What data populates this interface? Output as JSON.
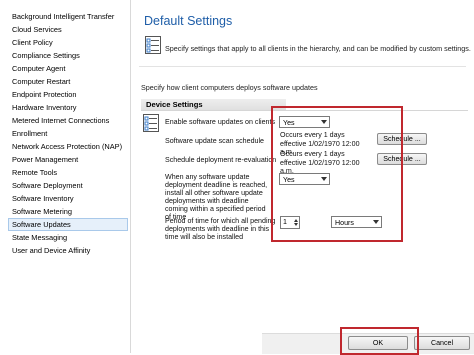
{
  "sidebar": {
    "items": [
      "Background Intelligent Transfer",
      "Cloud Services",
      "Client Policy",
      "Compliance Settings",
      "Computer Agent",
      "Computer Restart",
      "Endpoint Protection",
      "Hardware Inventory",
      "Metered Internet Connections",
      "Enrollment",
      "Network Access Protection (NAP)",
      "Power Management",
      "Remote Tools",
      "Software Deployment",
      "Software Inventory",
      "Software Metering",
      "Software Updates",
      "State Messaging",
      "User and Device Affinity"
    ],
    "selected": "Software Updates"
  },
  "main": {
    "title": "Default Settings",
    "description": "Specify settings that apply to all clients in the hierarchy, and can be modified by custom settings.",
    "sub_description": "Specify how client computers deploys software updates",
    "section_header": "Device Settings",
    "settings": {
      "enable_label": "Enable software updates on clients",
      "enable_value": "Yes",
      "scan_label": "Software update scan schedule",
      "scan_schedule": "Occurs every 1 days effective 1/02/1970 12:00 a.m.",
      "schedule_button": "Schedule ...",
      "reeval_label": "Schedule deployment re-evaluation",
      "reeval_schedule": "Occurs every 1 days effective 1/02/1970 12:00 a.m.",
      "deadline_label": "When any software update deployment deadline is reached, install all other software update deployments with deadline coming within a specified period of time",
      "deadline_value": "Yes",
      "period_label": "Period of time for which all pending deployments with deadline in this time will also be installed",
      "period_value": "1",
      "period_unit": "Hours"
    },
    "ok_button": "OK",
    "cancel_button": "Cancel"
  },
  "colors": {
    "title": "#1f5ea8",
    "highlight": "#c0282e",
    "selection": "#e6f0fa"
  }
}
